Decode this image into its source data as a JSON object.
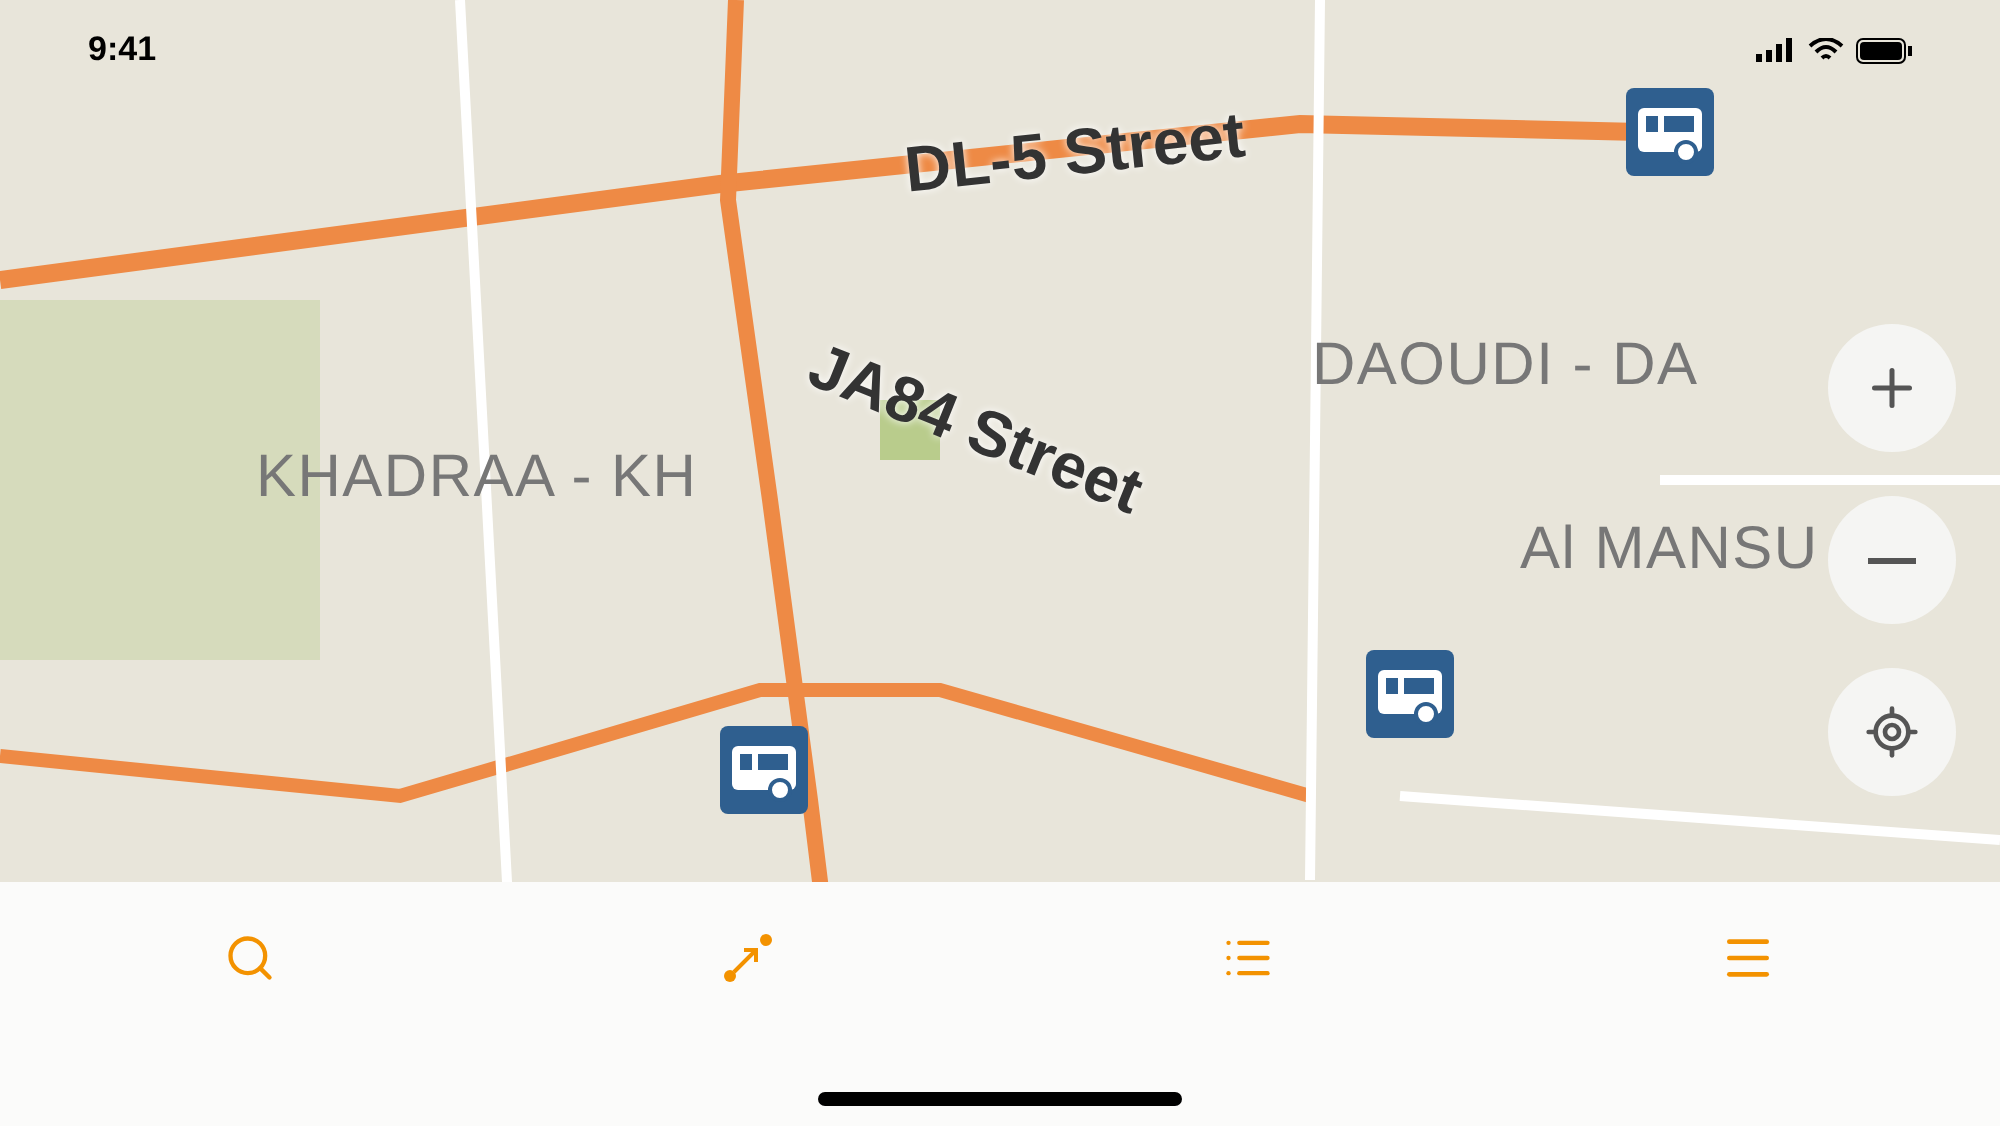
{
  "status_bar": {
    "time": "9:41"
  },
  "map": {
    "labels": [
      {
        "text": "DL-5 Street",
        "kind": "street"
      },
      {
        "text": "JA84 Street",
        "kind": "street"
      },
      {
        "text": "KHADRAA - KH",
        "kind": "district"
      },
      {
        "text": "DAOUDI - DA",
        "kind": "district"
      },
      {
        "text": "Al MANSU",
        "kind": "district"
      }
    ]
  }
}
